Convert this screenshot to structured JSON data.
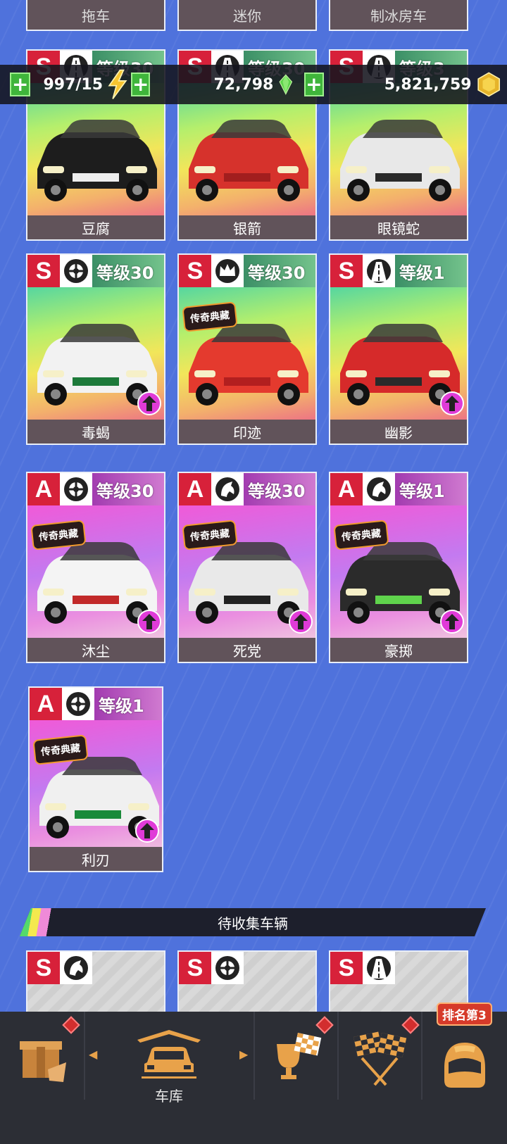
{
  "resources": {
    "fuel": "997/15",
    "gems": "72,798",
    "coins": "5,821,759"
  },
  "top_row_labels": [
    "拖车",
    "迷你",
    "制冰房车"
  ],
  "owned_cars": [
    {
      "name": "豆腐",
      "rank": "S",
      "level": "等级30",
      "class_icon": "road-icon",
      "legend": false,
      "upgrade": false
    },
    {
      "name": "银箭",
      "rank": "S",
      "level": "等级30",
      "class_icon": "road-icon",
      "legend": false,
      "upgrade": false
    },
    {
      "name": "眼镜蛇",
      "rank": "S",
      "level": "等级3",
      "class_icon": "road-icon",
      "legend": false,
      "upgrade": false
    },
    {
      "name": "毒蝎",
      "rank": "S",
      "level": "等级30",
      "class_icon": "tire-icon",
      "legend": false,
      "upgrade": true
    },
    {
      "name": "印迹",
      "rank": "S",
      "level": "等级30",
      "class_icon": "crown-icon",
      "legend": true,
      "upgrade": false
    },
    {
      "name": "幽影",
      "rank": "S",
      "level": "等级1",
      "class_icon": "road-icon",
      "legend": false,
      "upgrade": true
    },
    {
      "name": "沐尘",
      "rank": "A",
      "level": "等级30",
      "class_icon": "tire-icon",
      "legend": true,
      "upgrade": true
    },
    {
      "name": "死党",
      "rank": "A",
      "level": "等级30",
      "class_icon": "horse-icon",
      "legend": true,
      "upgrade": true
    },
    {
      "name": "豪掷",
      "rank": "A",
      "level": "等级1",
      "class_icon": "horse-icon",
      "legend": true,
      "upgrade": true
    },
    {
      "name": "利刃",
      "rank": "A",
      "level": "等级1",
      "class_icon": "tire-icon",
      "legend": true,
      "upgrade": true
    }
  ],
  "legend_badge": "传奇典藏",
  "uncollected_title": "待收集车辆",
  "uncollected_cars": [
    {
      "rank": "S",
      "class_icon": "horse-icon"
    },
    {
      "rank": "S",
      "class_icon": "tire-icon"
    },
    {
      "rank": "S",
      "class_icon": "road-icon"
    }
  ],
  "nav": {
    "garage_label": "车库",
    "rank_badge": "排名第3"
  },
  "colors": {
    "background": "#4f72dc",
    "rank_red": "#d7213a",
    "upgrade_magenta": "#e03bd8",
    "plus_green": "#3fb53b"
  }
}
